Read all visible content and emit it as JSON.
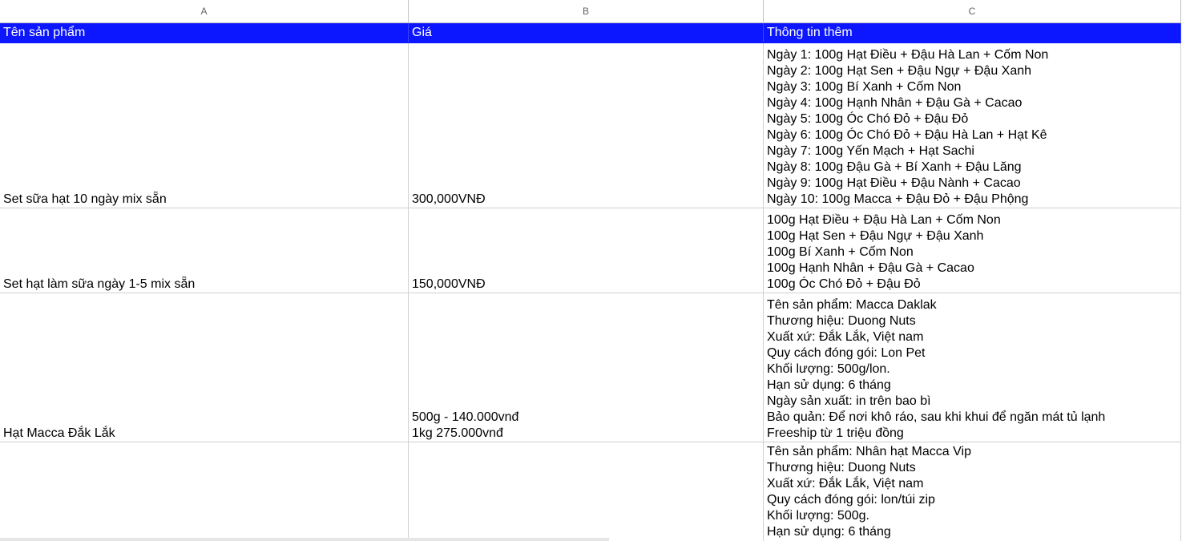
{
  "columns": [
    "A",
    "B",
    "C"
  ],
  "header": {
    "product_name": "Tên sản phẩm",
    "price": "Giá",
    "more_info": "Thông tin thêm"
  },
  "rows": [
    {
      "name": "Set sữa hạt 10 ngày mix sẵn",
      "price_lines": [
        "300,000VNĐ"
      ],
      "info_lines": [
        "Ngày 1: 100g Hạt Điều + Đậu Hà Lan + Cốm Non",
        "Ngày 2: 100g Hạt Sen + Đậu Ngự + Đậu Xanh",
        "Ngày 3: 100g Bí Xanh + Cốm Non",
        "Ngày 4: 100g Hạnh Nhân + Đậu Gà + Cacao",
        "Ngày 5: 100g Óc Chó Đỏ + Đậu Đỏ",
        "Ngày 6: 100g Óc Chó Đỏ + Đậu Hà Lan + Hạt Kê",
        "Ngày 7: 100g Yến Mạch + Hạt Sachi",
        "Ngày 8: 100g Đậu Gà + Bí Xanh + Đậu Lăng",
        "Ngày 9: 100g Hạt Điều + Đậu Nành + Cacao",
        "Ngày 10: 100g Macca + Đậu Đỏ + Đậu Phộng"
      ]
    },
    {
      "name": "Set hạt làm sữa ngày 1-5 mix sẵn",
      "price_lines": [
        "150,000VNĐ"
      ],
      "info_lines": [
        "100g Hạt Điều + Đậu Hà Lan + Cốm Non",
        "100g Hạt Sen + Đậu Ngự + Đậu Xanh",
        "100g Bí Xanh + Cốm Non",
        "100g Hạnh Nhân + Đậu Gà + Cacao",
        "100g Óc Chó Đỏ + Đậu Đỏ"
      ]
    },
    {
      "name": "Hạt Macca Đắk Lắk",
      "price_lines": [
        "500g - 140.000vnđ",
        "1kg 275.000vnđ"
      ],
      "info_lines": [
        "Tên sản phẩm: Macca Daklak",
        "Thương hiệu: Duong Nuts",
        "Xuất xứ: Đắk Lắk, Việt nam",
        "Quy cách đóng gói: Lon Pet",
        "Khối lượng: 500g/lon.",
        "Hạn sử dụng: 6 tháng",
        "Ngày sản xuất: in trên bao bì",
        "Bảo quản: Để nơi khô ráo, sau khi khui để ngăn mát tủ lạnh",
        "Freeship từ 1 triệu đồng"
      ]
    },
    {
      "name": "",
      "price_lines": [],
      "info_lines": [
        "Tên sản phẩm: Nhân hạt Macca Vip",
        "Thương hiệu: Duong Nuts",
        "Xuất xứ: Đắk Lắk, Việt nam",
        "Quy cách đóng gói: lon/túi zip",
        "Khối lượng: 500g.",
        "Hạn sử dụng: 6 tháng"
      ]
    }
  ]
}
